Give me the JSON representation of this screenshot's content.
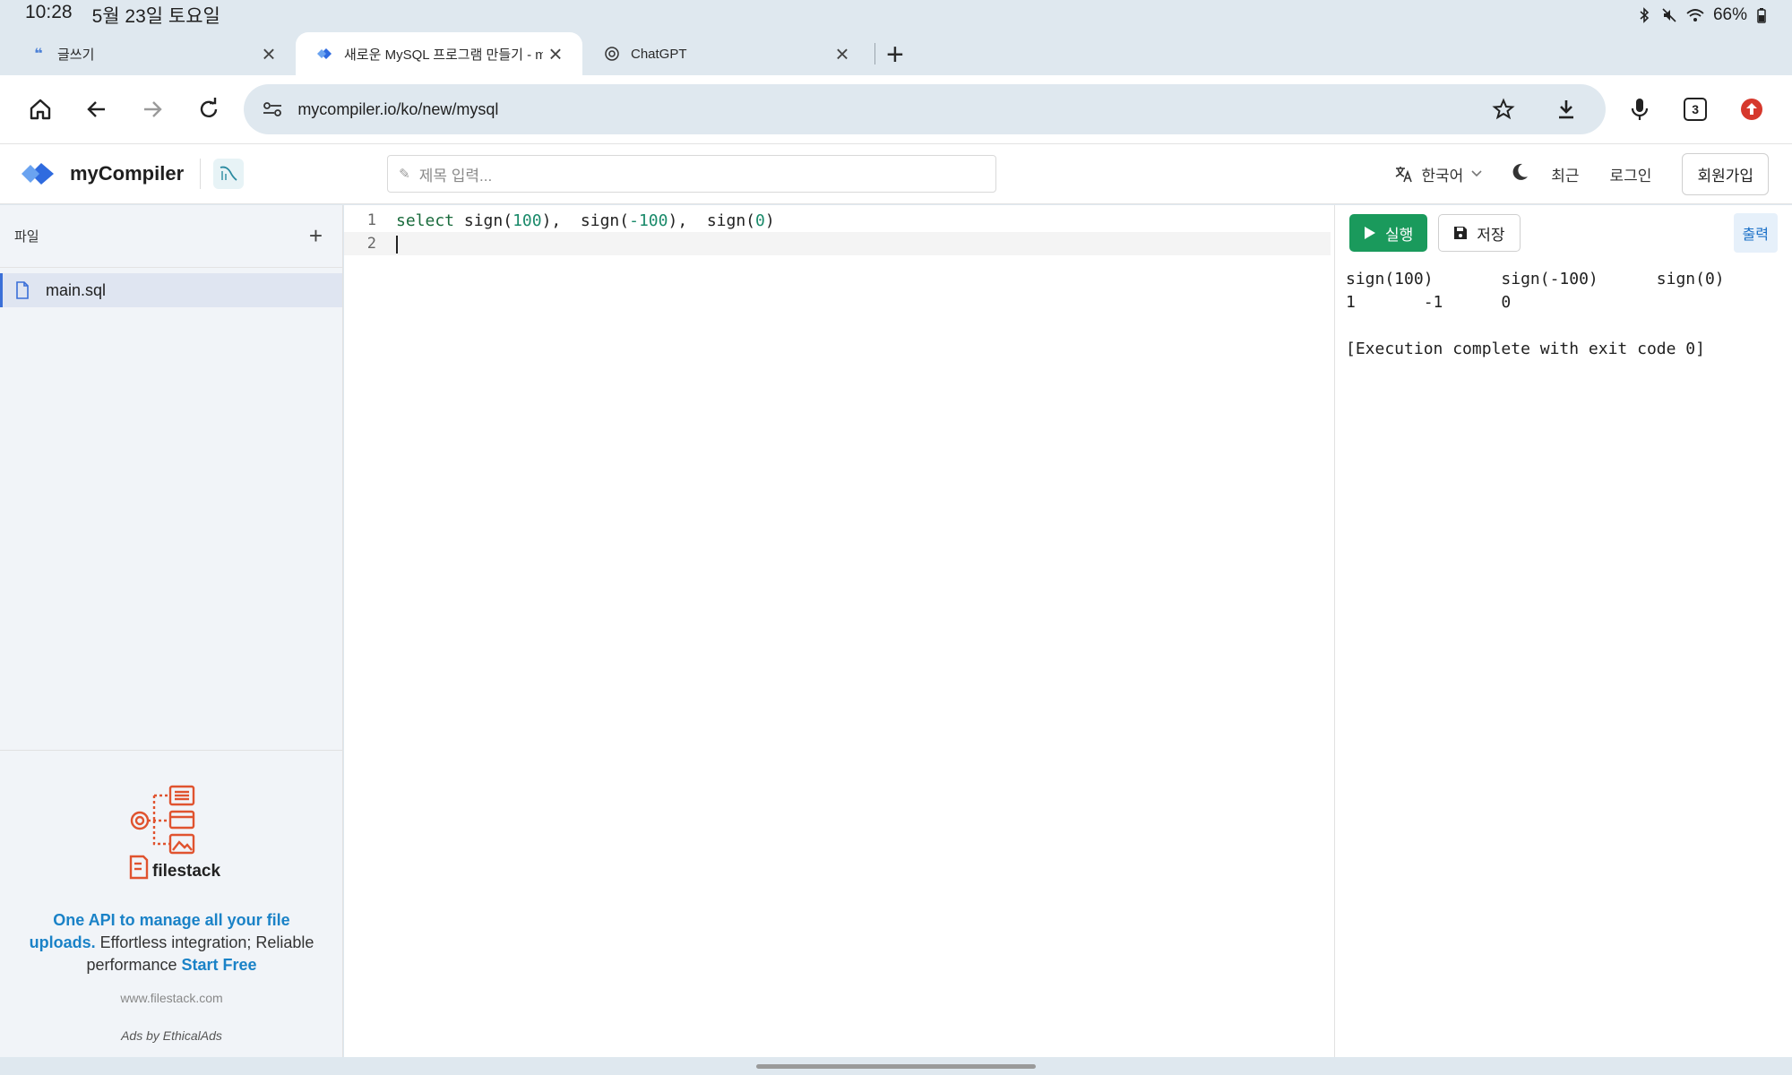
{
  "status_bar": {
    "time": "10:28",
    "date": "5월 23일 토요일",
    "battery": "66%"
  },
  "tabs": [
    {
      "title": "글쓰기",
      "icon": "quote-icon",
      "active": false
    },
    {
      "title": "새로운 MySQL 프로그램 만들기 - myCompiler",
      "icon": "mycompiler-icon",
      "active": true
    },
    {
      "title": "ChatGPT",
      "icon": "chatgpt-icon",
      "active": false
    }
  ],
  "toolbar": {
    "url": "mycompiler.io/ko/new/mysql",
    "tab_count": "3"
  },
  "app": {
    "brand": "myCompiler",
    "title_placeholder": "제목 입력...",
    "language": "한국어",
    "recent": "최근",
    "login": "로그인",
    "signup": "회원가입"
  },
  "sidebar": {
    "header": "파일",
    "files": [
      "main.sql"
    ]
  },
  "ad": {
    "brand": "filestack",
    "headline": "One API to manage all your file uploads.",
    "body": " Effortless integration; Reliable performance ",
    "cta": "Start Free",
    "site": "www.filestack.com",
    "by": "Ads by EthicalAds"
  },
  "editor": {
    "lines": [
      {
        "num": "1",
        "keyword": "select",
        "rest_a": " sign(",
        "n1": "100",
        "rest_b": "),  sign(",
        "n2": "-100",
        "rest_c": "),  sign(",
        "n3": "0",
        "rest_d": ")"
      },
      {
        "num": "2"
      }
    ]
  },
  "output": {
    "run_label": "실행",
    "save_label": "저장",
    "tab_label": "출력",
    "header_row": "sign(100)       sign(-100)      sign(0)",
    "value_row": "1       -1      0",
    "status": "[Execution complete with exit code 0]"
  },
  "colors": {
    "run_green": "#1a9a5c",
    "accent_blue": "#1a82c7",
    "filestack_red": "#e0532f"
  }
}
